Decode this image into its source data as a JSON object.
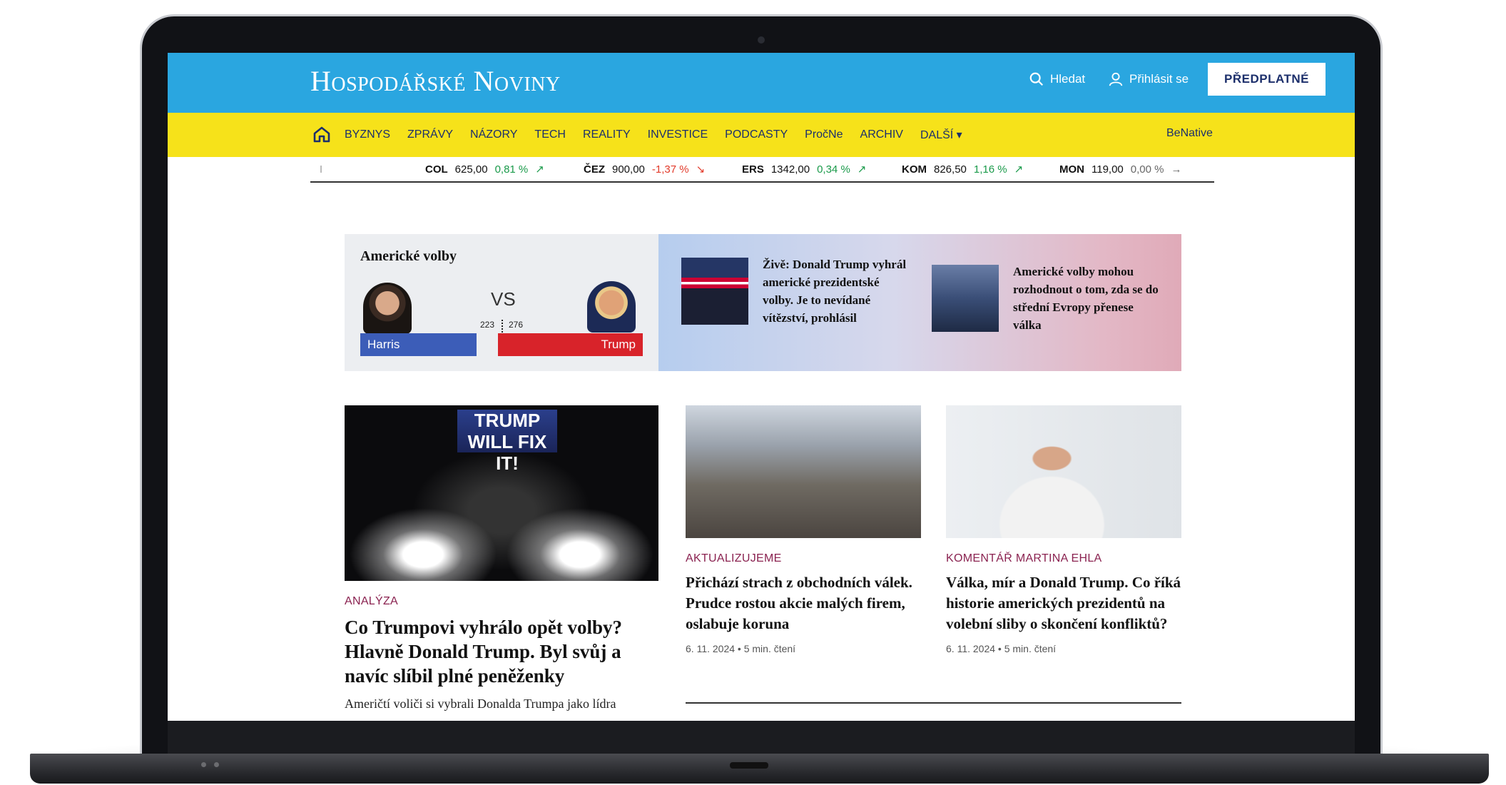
{
  "site": {
    "logo": "Hospodářské Noviny",
    "search_label": "Hledat",
    "login_label": "Přihlásit se",
    "subscribe_label": "PŘEDPLATNÉ"
  },
  "nav": {
    "items": [
      "BYZNYS",
      "ZPRÁVY",
      "NÁZORY",
      "TECH",
      "REALITY",
      "INVESTICE",
      "PODCASTY",
      "PročNe",
      "ARCHIV",
      "DALŠÍ ▾"
    ],
    "right": "BeNative"
  },
  "ticker": [
    {
      "symbol": "COL",
      "price": "625,00",
      "change": "0,81 %",
      "dir": "up",
      "arrow": "↗"
    },
    {
      "symbol": "ČEZ",
      "price": "900,00",
      "change": "-1,37 %",
      "dir": "down",
      "arrow": "↘"
    },
    {
      "symbol": "ERS",
      "price": "1342,00",
      "change": "0,34 %",
      "dir": "up",
      "arrow": "↗"
    },
    {
      "symbol": "KOM",
      "price": "826,50",
      "change": "1,16 %",
      "dir": "up",
      "arrow": "↗"
    },
    {
      "symbol": "MON",
      "price": "119,00",
      "change": "0,00 %",
      "dir": "flat",
      "arrow": "→"
    }
  ],
  "election": {
    "title": "Americké volby",
    "vs": "VS",
    "harris_label": "Harris",
    "trump_label": "Trump",
    "harris_votes": "223",
    "trump_votes": "276",
    "stories": [
      {
        "text": "Živě: Donald Trump vyhrál americké prezidentské volby. Je to nevídané vítězství, prohlásil"
      },
      {
        "text": "Americké volby mohou rozhodnout o tom, zda se do střední Evropy přenese válka"
      }
    ]
  },
  "articles": [
    {
      "kicker": "ANALÝZA",
      "headline": "Co Trumpovi vyhrálo opět volby? Hlavně Donald Trump. Byl svůj a navíc slíbil plné peněženky",
      "lede": "Američtí voliči si vybrali Donalda Trumpa jako lídra",
      "image_text": "TRUMP WILL FIX IT!"
    },
    {
      "kicker": "AKTUALIZUJEME",
      "headline": "Přichází strach z obchodních válek. Prudce rostou akcie malých firem, oslabuje koruna",
      "meta": "6. 11. 2024 • 5 min. čtení"
    },
    {
      "kicker": "KOMENTÁŘ MARTINA EHLA",
      "headline": "Válka, mír a Donald Trump. Co říká historie amerických prezidentů na volební sliby o skončení konfliktů?",
      "meta": "6. 11. 2024 • 5 min. čtení"
    }
  ]
}
